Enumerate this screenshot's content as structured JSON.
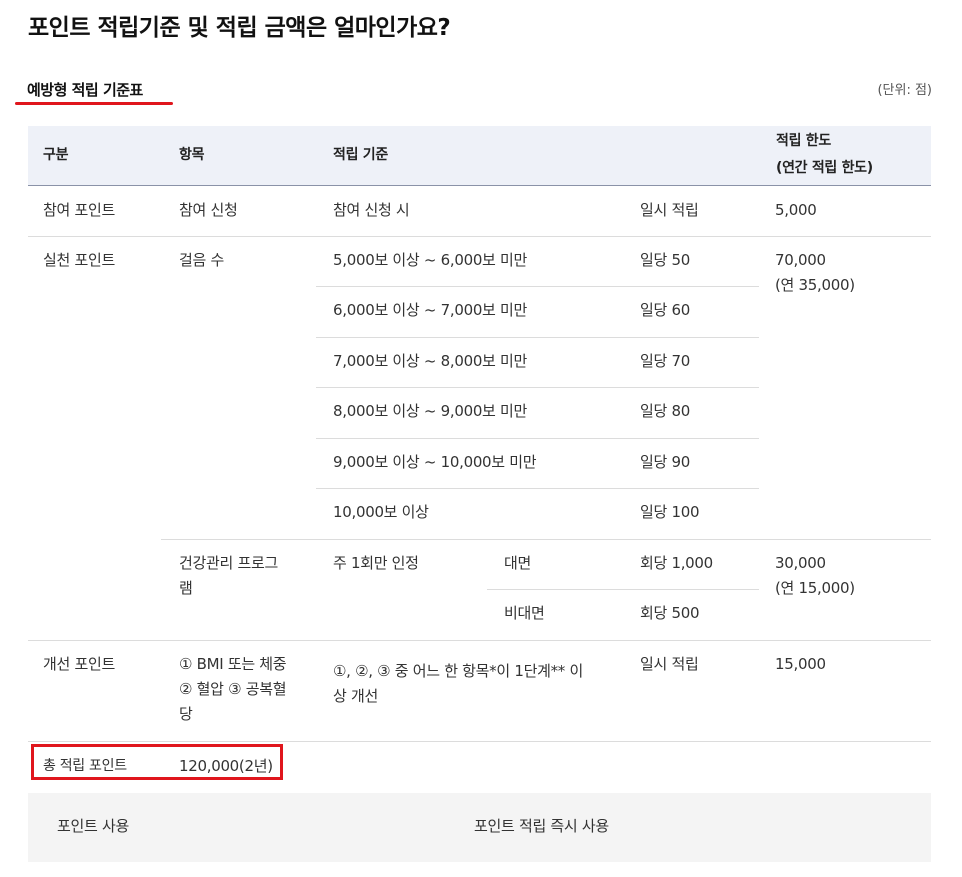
{
  "page": {
    "title": "포인트 적립기준 및 적립 금액은 얼마인가요?",
    "section_title": "예방형 적립 기준표",
    "unit_note": "(단위: 점)"
  },
  "table": {
    "headers": {
      "category": "구분",
      "item": "항목",
      "criteria": "적립 기준",
      "limit_line1": "적립 한도",
      "limit_line2": "(연간 적립 한도)"
    },
    "participation": {
      "category": "참여 포인트",
      "item": "참여 신청",
      "criteria": "참여 신청 시",
      "amount": "일시 적립",
      "limit": "5,000"
    },
    "practice": {
      "category": "실천 포인트",
      "walking_item": "걸음 수",
      "walking_rows": [
        {
          "criteria": "5,000보 이상 ~ 6,000보 미만",
          "amount": "일당 50"
        },
        {
          "criteria": "6,000보 이상 ~ 7,000보 미만",
          "amount": "일당 60"
        },
        {
          "criteria": "7,000보 이상 ~ 8,000보 미만",
          "amount": "일당 70"
        },
        {
          "criteria": "8,000보 이상 ~ 9,000보 미만",
          "amount": "일당 80"
        },
        {
          "criteria": "9,000보 이상 ~ 10,000보 미만",
          "amount": "일당 90"
        },
        {
          "criteria": "10,000보 이상",
          "amount": "일당 100"
        }
      ],
      "walking_limit_line1": "70,000",
      "walking_limit_line2": "(연 35,000)",
      "program_item_line1": "건강관리 프로그",
      "program_item_line2": "램",
      "program_criteria": "주 1회만 인정",
      "program_rows": [
        {
          "type": "대면",
          "amount": "회당 1,000"
        },
        {
          "type": "비대면",
          "amount": "회당 500"
        }
      ],
      "program_limit_line1": "30,000",
      "program_limit_line2": "(연 15,000)"
    },
    "improvement": {
      "category": "개선 포인트",
      "item_line1": "① BMI 또는 체중",
      "item_line2": "② 혈압 ③ 공복혈",
      "item_line3": "당",
      "criteria_line1": "①, ②, ③ 중 어느 한 항목*이 1단계** 이",
      "criteria_line2": "상 개선",
      "amount": "일시 적립",
      "limit": "15,000"
    },
    "total": {
      "label": "총 적립 포인트",
      "value": "120,000(2년)"
    },
    "usage": {
      "label": "포인트 사용",
      "value": "포인트 적립 즉시 사용"
    }
  },
  "colors": {
    "accent_red": "#e0161d",
    "header_bg": "#eef1f8",
    "footer_bg": "#f4f4f4"
  }
}
